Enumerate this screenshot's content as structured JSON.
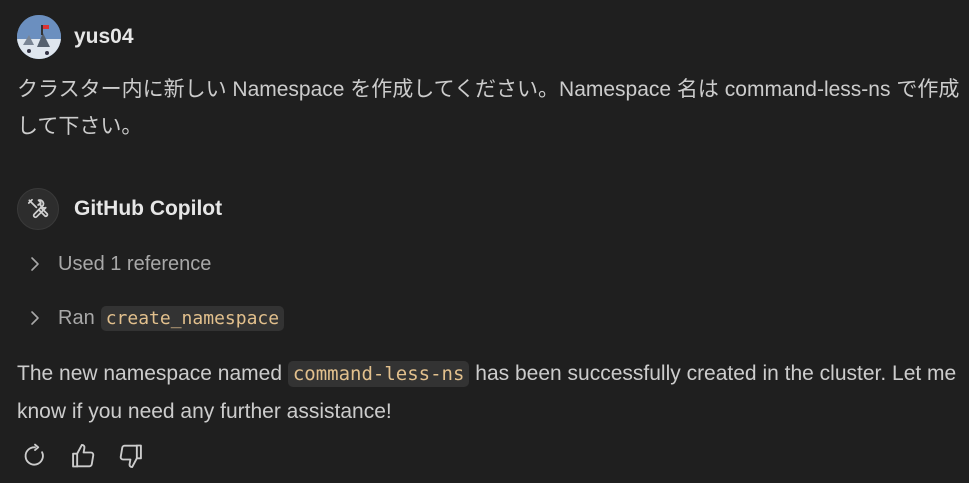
{
  "user": {
    "name": "yus04",
    "message": "クラスター内に新しい Namespace を作成してください。Namespace 名は command-less-ns で作成して下さい。"
  },
  "assistant": {
    "name": "GitHub Copilot",
    "used_references": "Used 1 reference",
    "ran_label": "Ran",
    "ran_tool": "create_namespace",
    "answer_prefix": "The new namespace named",
    "answer_code": "command-less-ns",
    "answer_suffix": "has been successfully created in the cluster. Let me know if you need any further assistance!"
  },
  "icons": {
    "bot": "tools-icon",
    "expand": "chevron-right-icon",
    "retry": "retry-icon",
    "like": "thumbs-up-icon",
    "dislike": "thumbs-down-icon"
  },
  "colors": {
    "background": "#1f1f1f",
    "text": "#cccccc",
    "code_text": "#e2c08d",
    "code_bg": "#333333"
  }
}
